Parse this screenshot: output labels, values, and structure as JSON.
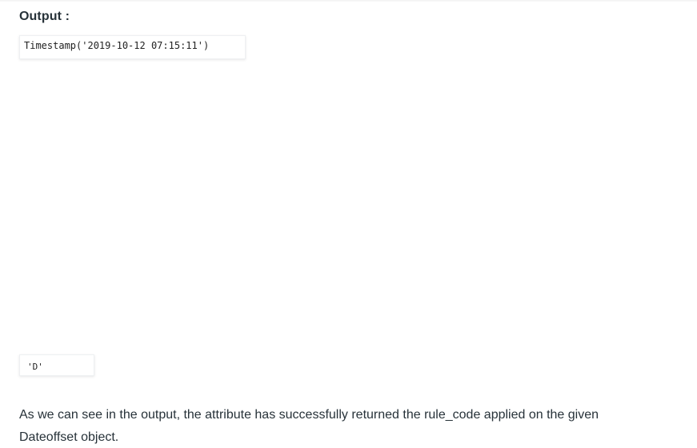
{
  "section": {
    "heading": "Output :"
  },
  "outputs": {
    "first": "Timestamp('2019-10-12 07:15:11')",
    "second": "'D'"
  },
  "paragraph": {
    "line1": "As we can see in the output, the attribute has successfully returned the rule_code applied on the given",
    "line2": "Dateoffset object."
  }
}
